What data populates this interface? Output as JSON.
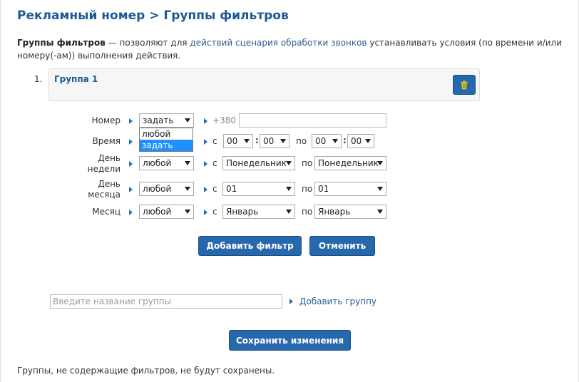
{
  "page": {
    "title": "Рекламный номер > Группы фильтров"
  },
  "description": {
    "term": "Группы фильтров",
    "text_before": " — позволяют для ",
    "link": "действий сценария обработки звонков",
    "text_after": " устанавливать условия (по времени и/или номеру(-ам)) выполнения действия."
  },
  "group": {
    "number": "1.",
    "name": "Группа 1",
    "delete_icon": "trash-icon",
    "accent_color": "#2767ac"
  },
  "filters": {
    "number": {
      "label": "Номер",
      "mode": "задать",
      "prefix": "+380",
      "value": ""
    },
    "time": {
      "label": "Время",
      "mode": "любой",
      "from_word": "с",
      "to_word": "по",
      "from_h": "00",
      "from_m": "00",
      "to_h": "00",
      "to_m": "00"
    },
    "weekday": {
      "label_line1": "День",
      "label_line2": "недели",
      "mode": "любой",
      "from_word": "с",
      "to_word": "по",
      "from": "Понедельник",
      "to": "Понедельник"
    },
    "monthday": {
      "label_line1": "День",
      "label_line2": "месяца",
      "mode": "любой",
      "from_word": "с",
      "to_word": "по",
      "from": "01",
      "to": "01"
    },
    "month": {
      "label": "Месяц",
      "mode": "любой",
      "from_word": "с",
      "to_word": "по",
      "from": "Январь",
      "to": "Январь"
    }
  },
  "dropdown": {
    "options": [
      "любой",
      "задать"
    ],
    "highlighted": "задать"
  },
  "buttons": {
    "add_filter": "Добавить фильтр",
    "cancel": "Отменить",
    "save": "Сохранить изменения"
  },
  "new_group": {
    "placeholder": "Введите название группы",
    "add_link": "Добавить группу"
  },
  "footer": {
    "note": "Группы, не содержащие фильтров, не будут сохранены."
  }
}
